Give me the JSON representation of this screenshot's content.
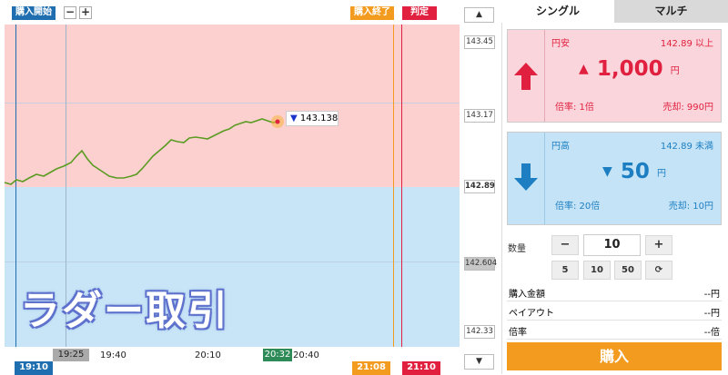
{
  "chart": {
    "start_label": "購入開始",
    "end_label": "購入終了",
    "judge_label": "判定",
    "zoom_out": "−",
    "zoom_in": "+",
    "current_price": "143.138",
    "y_ticks": [
      "143.45",
      "143.17",
      "142.89",
      "142.604",
      "142.33"
    ],
    "x_ticks": [
      "19:25",
      "19:40",
      "20:10",
      "20:32",
      "20:40"
    ],
    "start_time": "19:10",
    "end_time": "21:08",
    "judge_time": "21:10",
    "scroll_up": "▲",
    "scroll_down": "▼",
    "colors": {
      "up_zone": "#fdd0d0",
      "down_zone": "#c7e5f6",
      "line": "#5a9c22",
      "start": "#1f6fb0",
      "end": "#f39b1e",
      "judge": "#e0203e"
    }
  },
  "overlay_title": "ラダー取引",
  "tabs": {
    "single": "シングル",
    "multi": "マルチ"
  },
  "up_card": {
    "label": "円安",
    "threshold": "142.89 以上",
    "price": "1,000",
    "unit": "円",
    "rate": "倍率: 1倍",
    "sell": "売却: 990円",
    "arrow_icon": "arrow-up-icon"
  },
  "down_card": {
    "label": "円高",
    "threshold": "142.89 未満",
    "price": "50",
    "unit": "円",
    "rate": "倍率: 20倍",
    "sell": "売却: 10円",
    "arrow_icon": "arrow-down-icon"
  },
  "quantity": {
    "label": "数量",
    "minus": "−",
    "value": "10",
    "plus": "+",
    "presets": [
      "5",
      "10",
      "50"
    ],
    "reset_icon": "refresh-icon"
  },
  "summary": [
    {
      "label": "購入金額",
      "value": "--円"
    },
    {
      "label": "ペイアウト",
      "value": "--円"
    },
    {
      "label": "倍率",
      "value": "--倍"
    }
  ],
  "buy_button": "購入"
}
